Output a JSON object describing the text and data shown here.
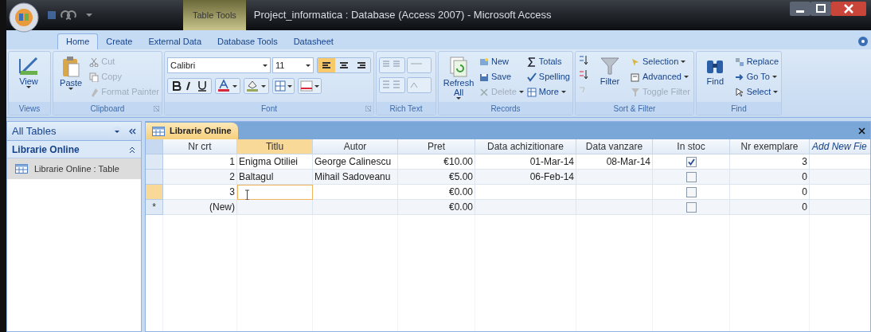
{
  "window": {
    "title": "Project_informatica : Database (Access 2007) - Microsoft Access",
    "context_tab": "Table Tools"
  },
  "tabs": [
    {
      "label": "Home",
      "selected": true
    },
    {
      "label": "Create",
      "selected": false
    },
    {
      "label": "External Data",
      "selected": false
    },
    {
      "label": "Database Tools",
      "selected": false
    },
    {
      "label": "Datasheet",
      "selected": false
    }
  ],
  "ribbon": {
    "views": {
      "label": "Views",
      "view_button": "View"
    },
    "clipboard": {
      "label": "Clipboard",
      "paste": "Paste",
      "small": [
        {
          "label": "Cut",
          "disabled": true
        },
        {
          "label": "Copy",
          "disabled": true
        },
        {
          "label": "Format Painter",
          "disabled": true
        }
      ]
    },
    "font": {
      "label": "Font",
      "font_name": "Calibri",
      "font_size": "11",
      "alignment": [
        {
          "selected": true
        },
        {
          "selected": false
        },
        {
          "selected": false
        }
      ]
    },
    "rich_text": {
      "label": "Rich Text"
    },
    "records": {
      "label": "Records",
      "refresh": "Refresh All",
      "small": [
        {
          "label": "New",
          "disabled": false,
          "dropdown": false
        },
        {
          "label": "Save",
          "disabled": false,
          "dropdown": false
        },
        {
          "label": "Delete",
          "disabled": true,
          "dropdown": true
        },
        {
          "label": "Totals",
          "disabled": false,
          "dropdown": false
        },
        {
          "label": "Spelling",
          "disabled": false,
          "dropdown": false
        },
        {
          "label": "More",
          "disabled": false,
          "dropdown": true
        }
      ]
    },
    "sort_filter": {
      "label": "Sort & Filter",
      "filter": "Filter",
      "small": [
        {
          "label": "Selection",
          "disabled": false,
          "dropdown": true
        },
        {
          "label": "Advanced",
          "disabled": false,
          "dropdown": true
        },
        {
          "label": "Toggle Filter",
          "disabled": true,
          "dropdown": false
        }
      ]
    },
    "find": {
      "label": "Find",
      "find": "Find",
      "small": [
        {
          "label": "Replace",
          "disabled": false,
          "dropdown": false
        },
        {
          "label": "Go To",
          "disabled": false,
          "dropdown": true
        },
        {
          "label": "Select",
          "disabled": false,
          "dropdown": true
        }
      ]
    }
  },
  "nav": {
    "title": "All Tables",
    "groups": [
      {
        "label": "Librarie Online",
        "expanded": true,
        "items": [
          {
            "label": "Librarie Online : Table",
            "selected": true
          }
        ]
      }
    ]
  },
  "document": {
    "tab": "Librarie Online",
    "columns": [
      {
        "label": "Nr crt",
        "kind": "number",
        "selected": false
      },
      {
        "label": "Titlu",
        "kind": "text",
        "selected": true
      },
      {
        "label": "Autor",
        "kind": "text",
        "selected": false
      },
      {
        "label": "Pret",
        "kind": "number",
        "selected": false
      },
      {
        "label": "Data achizitionare",
        "kind": "number",
        "selected": false
      },
      {
        "label": "Data vanzare",
        "kind": "number",
        "selected": false
      },
      {
        "label": "In stoc",
        "kind": "checkbox",
        "selected": false
      },
      {
        "label": "Nr exemplare",
        "kind": "number",
        "selected": false
      },
      {
        "label": "Add New Fie",
        "kind": "new",
        "selected": false
      }
    ],
    "rows": [
      {
        "selected": false,
        "cells": [
          "1",
          "Enigma Otiliei",
          "George Calinescu",
          "€10.00",
          "01-Mar-14",
          "08-Mar-14",
          true,
          "3",
          null
        ]
      },
      {
        "selected": false,
        "cells": [
          "2",
          "Baltagul",
          "Mihail Sadoveanu",
          "€5.00",
          "06-Feb-14",
          null,
          false,
          "0",
          null
        ]
      },
      {
        "selected": true,
        "cells": [
          "3",
          {
            "editing": true
          },
          null,
          "€0.00",
          null,
          null,
          false,
          "0",
          null
        ]
      },
      {
        "selected": false,
        "marker": "*",
        "cells": [
          "(New)",
          null,
          null,
          "€0.00",
          null,
          null,
          false,
          "0",
          null
        ]
      }
    ]
  }
}
